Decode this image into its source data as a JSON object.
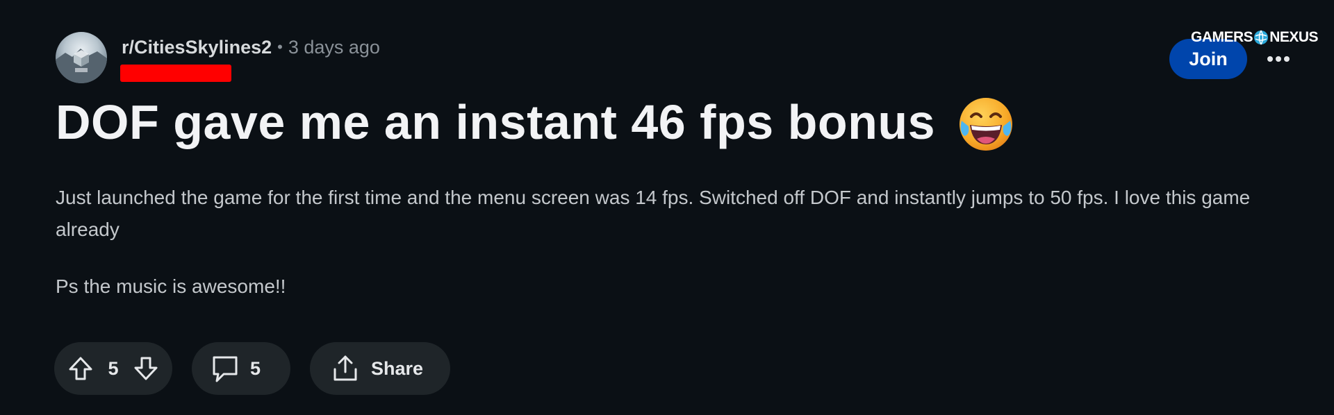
{
  "post": {
    "subreddit": "r/CitiesSkylines2",
    "separator": "•",
    "time_ago": "3 days ago",
    "title": "DOF gave me an instant 46 fps bonus",
    "title_emoji_icon": "face-with-tears-of-joy-icon",
    "body": [
      "Just launched the game for the first time and the menu screen was 14 fps. Switched off DOF and instantly jumps to 50 fps. I love this game already",
      "Ps the music is awesome!!"
    ]
  },
  "header": {
    "join_label": "Join",
    "more_icon": "ellipsis-icon",
    "watermark_left": "GAMERS",
    "watermark_right": "NEXUS"
  },
  "actions": {
    "vote_count": "5",
    "comment_count": "5",
    "share_label": "Share"
  },
  "colors": {
    "background": "#0b1015",
    "join_button": "#0045ac",
    "pill": "#1f2529",
    "redaction": "#ff0000"
  }
}
